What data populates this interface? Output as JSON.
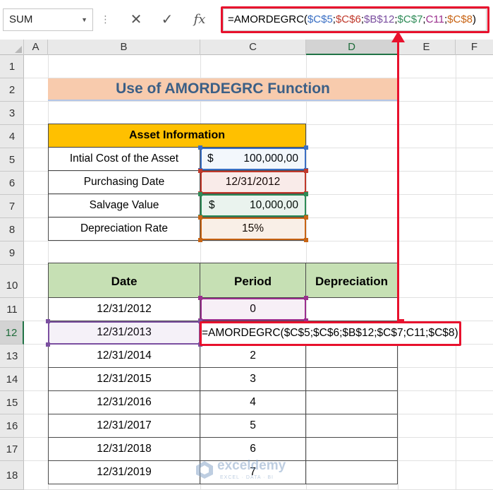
{
  "formula_bar": {
    "name_box": "SUM",
    "cancel_icon": "✕",
    "enter_icon": "✓",
    "fx_label": "fx",
    "formula_parts": [
      {
        "text": "=AMORDEGRC(",
        "color": "#000000"
      },
      {
        "text": "$C$5",
        "color": "#3a6fc4"
      },
      {
        "text": ";",
        "color": "#000000"
      },
      {
        "text": "$C$6",
        "color": "#c0392b"
      },
      {
        "text": ";",
        "color": "#000000"
      },
      {
        "text": "$B$12",
        "color": "#7b4fa0"
      },
      {
        "text": ";",
        "color": "#000000"
      },
      {
        "text": "$C$7",
        "color": "#2e8b57"
      },
      {
        "text": ";",
        "color": "#000000"
      },
      {
        "text": "C11",
        "color": "#9b2f8e"
      },
      {
        "text": ";",
        "color": "#000000"
      },
      {
        "text": "$C$8",
        "color": "#c86414"
      },
      {
        "text": ")",
        "color": "#000000"
      }
    ]
  },
  "columns": [
    "A",
    "B",
    "C",
    "D",
    "E",
    "F"
  ],
  "rows": [
    "1",
    "2",
    "3",
    "4",
    "5",
    "6",
    "7",
    "8",
    "9",
    "10",
    "11",
    "12",
    "13",
    "14",
    "15",
    "16",
    "17",
    "18"
  ],
  "sheet": {
    "title": "Use of AMORDEGRC Function",
    "asset_table": {
      "header": "Asset Information",
      "rows": [
        {
          "label": "Intial Cost of the Asset",
          "currency": "$",
          "value": "100,000,00"
        },
        {
          "label": "Purchasing Date",
          "currency": "",
          "value": "12/31/2012"
        },
        {
          "label": "Salvage Value",
          "currency": "$",
          "value": "10,000,00"
        },
        {
          "label": "Depreciation Rate",
          "currency": "",
          "value": "15%"
        }
      ]
    },
    "data_table": {
      "headers": [
        "Date",
        "Period",
        "Depreciation"
      ],
      "rows": [
        {
          "date": "12/31/2012",
          "period": "0",
          "depreciation": ""
        },
        {
          "date": "12/31/2013",
          "period": "",
          "depreciation": ""
        },
        {
          "date": "12/31/2014",
          "period": "2",
          "depreciation": ""
        },
        {
          "date": "12/31/2015",
          "period": "3",
          "depreciation": ""
        },
        {
          "date": "12/31/2016",
          "period": "4",
          "depreciation": ""
        },
        {
          "date": "12/31/2017",
          "period": "5",
          "depreciation": ""
        },
        {
          "date": "12/31/2018",
          "period": "6",
          "depreciation": ""
        },
        {
          "date": "12/31/2019",
          "period": "7",
          "depreciation": ""
        }
      ]
    },
    "editing_formula": "=AMORDEGRC($C$5;$C$6;$B$12;$C$7;C11;$C$8)"
  },
  "watermark": {
    "name": "exceldemy",
    "tagline": "EXCEL · DATA · BI"
  },
  "colors": {
    "title_fill": "#f8cbad",
    "title_text": "#3b5f86",
    "asset_header_fill": "#ffc000",
    "table_header_fill": "#c6e0b4",
    "highlight_red": "#e8112d"
  }
}
